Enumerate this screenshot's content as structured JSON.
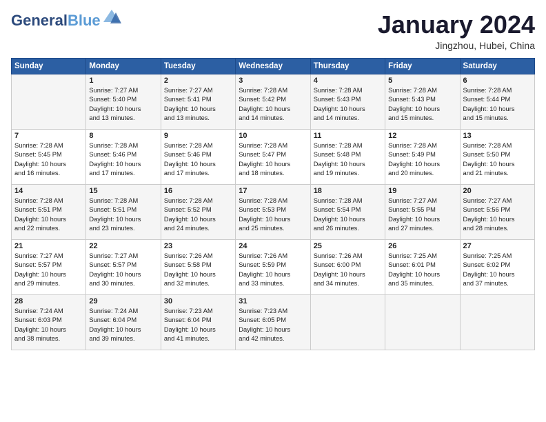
{
  "header": {
    "logo_line1": "General",
    "logo_line2": "Blue",
    "title": "January 2024",
    "subtitle": "Jingzhou, Hubei, China"
  },
  "weekdays": [
    "Sunday",
    "Monday",
    "Tuesday",
    "Wednesday",
    "Thursday",
    "Friday",
    "Saturday"
  ],
  "weeks": [
    [
      {
        "day": "",
        "info": ""
      },
      {
        "day": "1",
        "info": "Sunrise: 7:27 AM\nSunset: 5:40 PM\nDaylight: 10 hours\nand 13 minutes."
      },
      {
        "day": "2",
        "info": "Sunrise: 7:27 AM\nSunset: 5:41 PM\nDaylight: 10 hours\nand 13 minutes."
      },
      {
        "day": "3",
        "info": "Sunrise: 7:28 AM\nSunset: 5:42 PM\nDaylight: 10 hours\nand 14 minutes."
      },
      {
        "day": "4",
        "info": "Sunrise: 7:28 AM\nSunset: 5:43 PM\nDaylight: 10 hours\nand 14 minutes."
      },
      {
        "day": "5",
        "info": "Sunrise: 7:28 AM\nSunset: 5:43 PM\nDaylight: 10 hours\nand 15 minutes."
      },
      {
        "day": "6",
        "info": "Sunrise: 7:28 AM\nSunset: 5:44 PM\nDaylight: 10 hours\nand 15 minutes."
      }
    ],
    [
      {
        "day": "7",
        "info": "Sunrise: 7:28 AM\nSunset: 5:45 PM\nDaylight: 10 hours\nand 16 minutes."
      },
      {
        "day": "8",
        "info": "Sunrise: 7:28 AM\nSunset: 5:46 PM\nDaylight: 10 hours\nand 17 minutes."
      },
      {
        "day": "9",
        "info": "Sunrise: 7:28 AM\nSunset: 5:46 PM\nDaylight: 10 hours\nand 17 minutes."
      },
      {
        "day": "10",
        "info": "Sunrise: 7:28 AM\nSunset: 5:47 PM\nDaylight: 10 hours\nand 18 minutes."
      },
      {
        "day": "11",
        "info": "Sunrise: 7:28 AM\nSunset: 5:48 PM\nDaylight: 10 hours\nand 19 minutes."
      },
      {
        "day": "12",
        "info": "Sunrise: 7:28 AM\nSunset: 5:49 PM\nDaylight: 10 hours\nand 20 minutes."
      },
      {
        "day": "13",
        "info": "Sunrise: 7:28 AM\nSunset: 5:50 PM\nDaylight: 10 hours\nand 21 minutes."
      }
    ],
    [
      {
        "day": "14",
        "info": "Sunrise: 7:28 AM\nSunset: 5:51 PM\nDaylight: 10 hours\nand 22 minutes."
      },
      {
        "day": "15",
        "info": "Sunrise: 7:28 AM\nSunset: 5:51 PM\nDaylight: 10 hours\nand 23 minutes."
      },
      {
        "day": "16",
        "info": "Sunrise: 7:28 AM\nSunset: 5:52 PM\nDaylight: 10 hours\nand 24 minutes."
      },
      {
        "day": "17",
        "info": "Sunrise: 7:28 AM\nSunset: 5:53 PM\nDaylight: 10 hours\nand 25 minutes."
      },
      {
        "day": "18",
        "info": "Sunrise: 7:28 AM\nSunset: 5:54 PM\nDaylight: 10 hours\nand 26 minutes."
      },
      {
        "day": "19",
        "info": "Sunrise: 7:27 AM\nSunset: 5:55 PM\nDaylight: 10 hours\nand 27 minutes."
      },
      {
        "day": "20",
        "info": "Sunrise: 7:27 AM\nSunset: 5:56 PM\nDaylight: 10 hours\nand 28 minutes."
      }
    ],
    [
      {
        "day": "21",
        "info": "Sunrise: 7:27 AM\nSunset: 5:57 PM\nDaylight: 10 hours\nand 29 minutes."
      },
      {
        "day": "22",
        "info": "Sunrise: 7:27 AM\nSunset: 5:57 PM\nDaylight: 10 hours\nand 30 minutes."
      },
      {
        "day": "23",
        "info": "Sunrise: 7:26 AM\nSunset: 5:58 PM\nDaylight: 10 hours\nand 32 minutes."
      },
      {
        "day": "24",
        "info": "Sunrise: 7:26 AM\nSunset: 5:59 PM\nDaylight: 10 hours\nand 33 minutes."
      },
      {
        "day": "25",
        "info": "Sunrise: 7:26 AM\nSunset: 6:00 PM\nDaylight: 10 hours\nand 34 minutes."
      },
      {
        "day": "26",
        "info": "Sunrise: 7:25 AM\nSunset: 6:01 PM\nDaylight: 10 hours\nand 35 minutes."
      },
      {
        "day": "27",
        "info": "Sunrise: 7:25 AM\nSunset: 6:02 PM\nDaylight: 10 hours\nand 37 minutes."
      }
    ],
    [
      {
        "day": "28",
        "info": "Sunrise: 7:24 AM\nSunset: 6:03 PM\nDaylight: 10 hours\nand 38 minutes."
      },
      {
        "day": "29",
        "info": "Sunrise: 7:24 AM\nSunset: 6:04 PM\nDaylight: 10 hours\nand 39 minutes."
      },
      {
        "day": "30",
        "info": "Sunrise: 7:23 AM\nSunset: 6:04 PM\nDaylight: 10 hours\nand 41 minutes."
      },
      {
        "day": "31",
        "info": "Sunrise: 7:23 AM\nSunset: 6:05 PM\nDaylight: 10 hours\nand 42 minutes."
      },
      {
        "day": "",
        "info": ""
      },
      {
        "day": "",
        "info": ""
      },
      {
        "day": "",
        "info": ""
      }
    ]
  ]
}
